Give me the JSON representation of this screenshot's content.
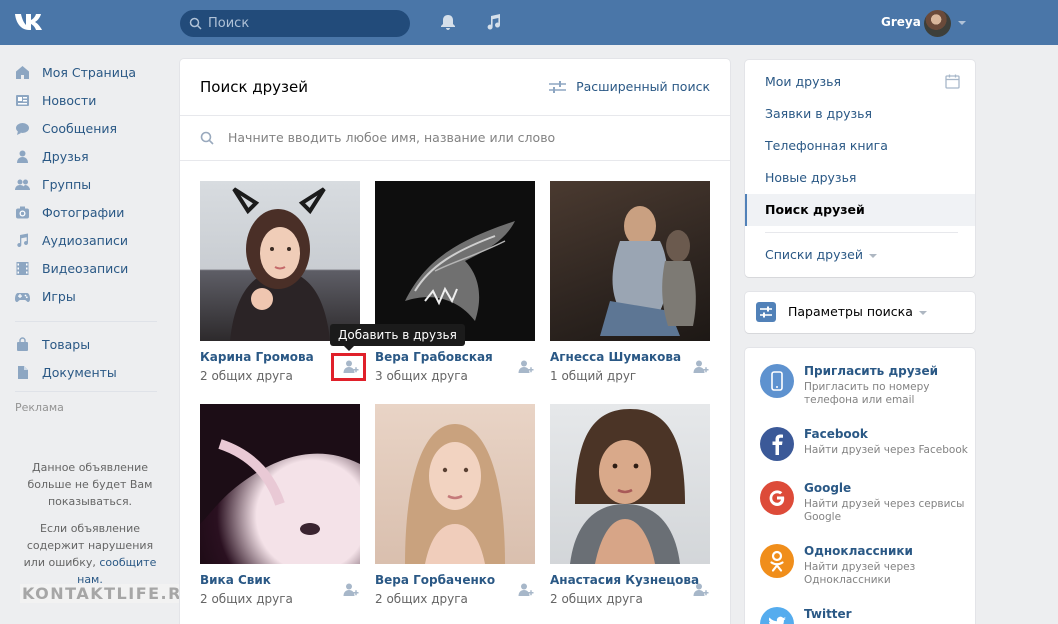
{
  "header": {
    "search_placeholder": "Поиск",
    "user_name": "Greya"
  },
  "nav": {
    "items": [
      {
        "label": "Моя Страница",
        "icon": "home-icon"
      },
      {
        "label": "Новости",
        "icon": "news-icon"
      },
      {
        "label": "Сообщения",
        "icon": "messages-icon"
      },
      {
        "label": "Друзья",
        "icon": "friends-icon"
      },
      {
        "label": "Группы",
        "icon": "groups-icon"
      },
      {
        "label": "Фотографии",
        "icon": "camera-icon"
      },
      {
        "label": "Аудиозаписи",
        "icon": "music-icon"
      },
      {
        "label": "Видеозаписи",
        "icon": "video-icon"
      },
      {
        "label": "Игры",
        "icon": "gamepad-icon"
      }
    ],
    "items2": [
      {
        "label": "Товары",
        "icon": "bag-icon"
      },
      {
        "label": "Документы",
        "icon": "document-icon"
      }
    ],
    "ads_label": "Реклама",
    "ad_notice": "Данное объявление больше не будет Вам показываться.",
    "ad_report_prefix": "Если объявление содержит нарушения или ошибку,",
    "ad_report_link": "сообщите нам."
  },
  "watermark": "KONTAKTLIFE.RU",
  "main": {
    "title": "Поиск друзей",
    "advanced_search": "Расширенный поиск",
    "search_placeholder": "Начните вводить любое имя, название или слово",
    "tooltip": "Добавить в друзья",
    "people": [
      {
        "name": "Карина Громова",
        "mutual": "2 общих друга"
      },
      {
        "name": "Вера Грабовская",
        "mutual": "3 общих друга"
      },
      {
        "name": "Агнесса Шумакова",
        "mutual": "1 общий друг"
      },
      {
        "name": "Вика Свик",
        "mutual": "2 общих друга"
      },
      {
        "name": "Вера Горбаченко",
        "mutual": "2 общих друга"
      },
      {
        "name": "Анастасия Кузнецова",
        "mutual": "2 общих друга"
      }
    ]
  },
  "right_menu": {
    "items": [
      "Мои друзья",
      "Заявки в друзья",
      "Телефонная книга",
      "Новые друзья"
    ],
    "active": "Поиск друзей",
    "lists": "Списки друзей"
  },
  "params": {
    "label": "Параметры поиска"
  },
  "invite": [
    {
      "title": "Пригласить друзей",
      "subtitle": "Пригласить по номеру телефона или email",
      "color": "#5e92cf"
    },
    {
      "title": "Facebook",
      "subtitle": "Найти друзей через Facebook",
      "color": "#3b5998"
    },
    {
      "title": "Google",
      "subtitle": "Найти друзей через сервисы Google",
      "color": "#dd4b39"
    },
    {
      "title": "Одноклассники",
      "subtitle": "Найти друзей через Одноклассники",
      "color": "#f08e1b"
    },
    {
      "title": "Twitter",
      "subtitle": "",
      "color": "#55acee"
    }
  ]
}
